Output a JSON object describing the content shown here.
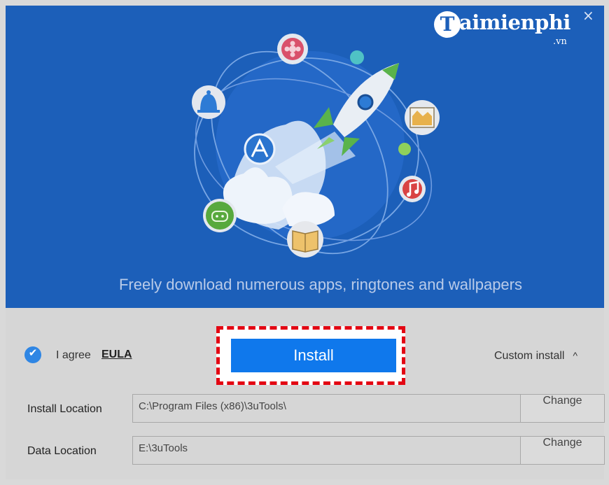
{
  "colors": {
    "hero_bg": "#1c5fb9",
    "install_blue": "#0f78ec",
    "highlight_red": "#e30613",
    "check_blue": "#2f86e4"
  },
  "logo": {
    "mark": "T",
    "text": "aimienphi",
    "sub": ".vn"
  },
  "window": {
    "close_label": "×"
  },
  "hero": {
    "tagline": "Freely download numerous apps, ringtones and wallpapers",
    "icons": [
      "rocket-icon",
      "app-store-icon",
      "bell-icon",
      "flower-icon",
      "video-icon",
      "music-icon",
      "book-icon",
      "robot-icon"
    ]
  },
  "agree": {
    "check_glyph": "✔",
    "label": "I agree",
    "eula": "EULA"
  },
  "install": {
    "label": "Install"
  },
  "custom": {
    "label": "Custom install",
    "caret": "^"
  },
  "install_location": {
    "label": "Install Location",
    "value": "C:\\Program Files (x86)\\3uTools\\",
    "button": "Change"
  },
  "data_location": {
    "label": "Data Location",
    "value": "E:\\3uTools",
    "button": "Change"
  }
}
